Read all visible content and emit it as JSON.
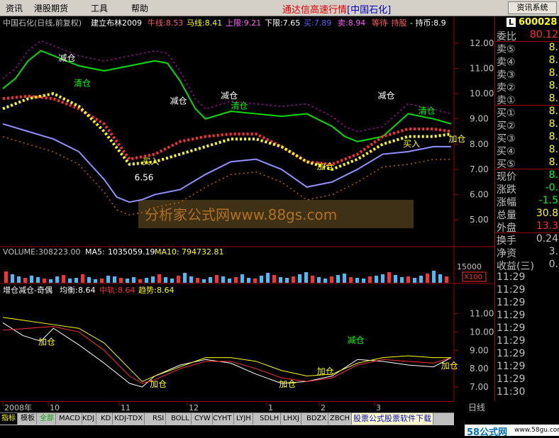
{
  "menu": {
    "items": [
      "资讯",
      "港股期货",
      "工具",
      "帮助"
    ],
    "title_prefix": "通达信高速行情",
    "title_code": "[中国石化]",
    "info_button": "资讯系统"
  },
  "header": {
    "title": "中国石化(日线,前复权)",
    "indicator": "建立布林2009",
    "params": [
      {
        "label": "牛线:",
        "value": "8.53",
        "color": "#ff6060"
      },
      {
        "label": "马线:",
        "value": "8.41",
        "color": "#ffff00"
      },
      {
        "label": "上限:",
        "value": "9.21",
        "color": "#ff60ff"
      },
      {
        "label": "下限:",
        "value": "7.65",
        "color": "#ffffff"
      },
      {
        "label": "买:",
        "value": "7.89",
        "color": "#6060ff"
      },
      {
        "label": "卖:",
        "value": "8.94",
        "color": "#ff60ff"
      },
      {
        "label": "等待",
        "value": "",
        "color": "#ff6060"
      },
      {
        "label": "- 持股",
        "value": "",
        "color": "#ff6060"
      },
      {
        "label": "- 持币:",
        "value": "8.9",
        "color": "#ffffff"
      }
    ]
  },
  "volume": {
    "label": "VOLUME:",
    "value": "308223.00",
    "ma5_label": "MA5:",
    "ma5": "1035059.19",
    "ma10_label": "MA10:",
    "ma10": "794732.81",
    "axis": "15000",
    "unit": "X100"
  },
  "sub": {
    "name": "增仓减仓-奇偶",
    "balance_label": "均衡:",
    "balance": "8.64",
    "mid_label": "中轨:",
    "mid": "8.64",
    "trend_label": "趋势:",
    "trend": "8.64"
  },
  "watermark": "分析家公式网www.88gs.com",
  "chart_data": [
    {
      "type": "line",
      "title": "中国石化(日线,前复权)",
      "y_ticks": [
        "12.00",
        "11.00",
        "10.00",
        "9.00",
        "8.00",
        "7.00",
        "6.00",
        "5.00"
      ],
      "ylim": [
        4.5,
        12.5
      ],
      "x_labels": [
        "2008年",
        "10",
        "11",
        "12",
        "1",
        "2",
        "3"
      ],
      "series": [
        {
          "name": "上限",
          "color": "#00e000",
          "x": [
            0,
            5,
            10,
            15,
            20,
            30,
            40,
            50,
            60,
            65,
            70,
            76,
            80,
            90,
            100,
            110,
            120,
            130,
            135,
            140,
            150,
            160,
            170,
            177
          ],
          "values": [
            10.2,
            10.6,
            11.3,
            11.7,
            11.5,
            11.1,
            10.9,
            11.1,
            11.3,
            11.2,
            10.5,
            9.4,
            9.0,
            9.3,
            9.2,
            9.1,
            9.2,
            8.7,
            8.3,
            8.1,
            8.3,
            9.2,
            9.0,
            8.8
          ]
        },
        {
          "name": "下限",
          "color": "#9090ff",
          "x": [
            0,
            10,
            20,
            30,
            40,
            45,
            50,
            55,
            60,
            70,
            80,
            90,
            100,
            110,
            120,
            130,
            140,
            150,
            160,
            170,
            177
          ],
          "values": [
            8.8,
            8.5,
            8.2,
            7.7,
            6.6,
            5.9,
            5.7,
            5.8,
            6.0,
            6.2,
            6.8,
            7.3,
            7.4,
            7.0,
            6.3,
            6.5,
            7.0,
            7.6,
            7.7,
            7.9,
            7.9
          ]
        },
        {
          "name": "牛线",
          "color": "#ff3030",
          "x": [
            0,
            10,
            20,
            30,
            40,
            50,
            60,
            70,
            80,
            90,
            100,
            110,
            120,
            130,
            140,
            150,
            160,
            170,
            177
          ],
          "values": [
            9.8,
            9.9,
            9.8,
            9.4,
            8.8,
            7.4,
            7.6,
            8.1,
            8.3,
            8.4,
            8.4,
            7.9,
            7.3,
            7.2,
            7.6,
            8.3,
            8.6,
            8.6,
            8.5
          ]
        },
        {
          "name": "马线",
          "color": "#ffff00",
          "x": [
            0,
            10,
            20,
            30,
            40,
            50,
            60,
            70,
            80,
            90,
            100,
            110,
            120,
            130,
            140,
            150,
            160,
            170,
            177
          ],
          "values": [
            9.4,
            9.8,
            10.0,
            9.5,
            8.5,
            7.2,
            7.3,
            7.6,
            7.9,
            8.2,
            8.2,
            7.9,
            7.3,
            7.0,
            7.4,
            8.0,
            8.3,
            8.3,
            8.4
          ]
        }
      ],
      "annotations": [
        {
          "text": "减仓",
          "x": 22,
          "y": 11.3,
          "color": "#ffffff"
        },
        {
          "text": "清仓",
          "x": 28,
          "y": 10.3,
          "color": "#00ff00"
        },
        {
          "text": "买入",
          "x": 55,
          "y": 7.2,
          "color": "#ffff00"
        },
        {
          "text": "6.56",
          "x": 52,
          "y": 6.56,
          "color": "#ffffff"
        },
        {
          "text": "减仓",
          "x": 66,
          "y": 9.6,
          "color": "#ffffff"
        },
        {
          "text": "减仓",
          "x": 86,
          "y": 9.8,
          "color": "#ffffff"
        },
        {
          "text": "清仓",
          "x": 90,
          "y": 9.4,
          "color": "#00ff00"
        },
        {
          "text": "加仓",
          "x": 124,
          "y": 7.0,
          "color": "#ffff00"
        },
        {
          "text": "减仓",
          "x": 148,
          "y": 9.8,
          "color": "#ffffff"
        },
        {
          "text": "清仓",
          "x": 164,
          "y": 9.2,
          "color": "#00ff00"
        },
        {
          "text": "买入",
          "x": 158,
          "y": 7.9,
          "color": "#ffff00"
        },
        {
          "text": "加仓",
          "x": 176,
          "y": 8.1,
          "color": "#ffff00"
        }
      ]
    },
    {
      "type": "line",
      "title": "增仓减仓-奇偶",
      "y_ticks": [
        "11.00",
        "10.00",
        "9.00",
        "8.00",
        "7.00"
      ],
      "ylim": [
        6.5,
        11.6
      ],
      "series": [
        {
          "name": "均衡",
          "color": "#ffffff",
          "x": [
            0,
            8,
            15,
            20,
            30,
            40,
            50,
            55,
            60,
            70,
            80,
            90,
            100,
            110,
            120,
            130,
            140,
            150,
            160,
            170,
            177
          ],
          "values": [
            10.5,
            9.8,
            9.5,
            10.2,
            9.3,
            8.3,
            7.2,
            7.0,
            7.6,
            8.2,
            8.5,
            8.3,
            7.7,
            7.2,
            7.3,
            7.6,
            8.5,
            8.4,
            8.2,
            8.1,
            8.6
          ]
        },
        {
          "name": "中轨",
          "color": "#ff3030",
          "x": [
            0,
            10,
            20,
            30,
            40,
            50,
            55,
            60,
            70,
            80,
            90,
            100,
            110,
            120,
            130,
            140,
            150,
            160,
            170,
            177
          ],
          "values": [
            10.1,
            10.2,
            10.3,
            10.0,
            9.0,
            7.6,
            7.2,
            7.4,
            8.0,
            8.4,
            8.4,
            8.0,
            7.5,
            7.3,
            7.5,
            8.2,
            8.5,
            8.4,
            8.3,
            8.6
          ]
        },
        {
          "name": "趋势",
          "color": "#ffff00",
          "x": [
            0,
            10,
            20,
            30,
            40,
            50,
            55,
            60,
            70,
            80,
            90,
            100,
            110,
            120,
            130,
            140,
            150,
            160,
            170,
            177
          ],
          "values": [
            10.8,
            10.6,
            10.4,
            10.2,
            9.4,
            8.0,
            7.3,
            7.6,
            8.1,
            8.6,
            8.6,
            8.4,
            7.9,
            7.6,
            7.7,
            8.3,
            8.6,
            8.7,
            8.6,
            8.6
          ]
        }
      ],
      "annotations": [
        {
          "text": "加仓",
          "x": 14,
          "y": 9.3,
          "color": "#ffff00"
        },
        {
          "text": "加仓",
          "x": 58,
          "y": 7.0,
          "color": "#ffff00"
        },
        {
          "text": "加仓",
          "x": 109,
          "y": 7.0,
          "color": "#ffff00"
        },
        {
          "text": "加仓",
          "x": 124,
          "y": 7.7,
          "color": "#ffff00"
        },
        {
          "text": "减仓",
          "x": 136,
          "y": 9.4,
          "color": "#00ff00"
        },
        {
          "text": "加仓",
          "x": 173,
          "y": 8.0,
          "color": "#ffff00"
        }
      ]
    }
  ],
  "side": {
    "code": "600028",
    "rows": [
      {
        "label": "委比",
        "value": "80.12",
        "color": "#ff3030"
      },
      {
        "label": "卖⑤",
        "value": "8.",
        "color": "#ffff00"
      },
      {
        "label": "卖④",
        "value": "8.",
        "color": "#ffff00"
      },
      {
        "label": "卖③",
        "value": "8.",
        "color": "#ffff00"
      },
      {
        "label": "卖②",
        "value": "8.",
        "color": "#ffff00"
      },
      {
        "label": "卖①",
        "value": "8.",
        "color": "#ffff00"
      },
      {
        "label": "买①",
        "value": "8.",
        "color": "#ffff00"
      },
      {
        "label": "买②",
        "value": "8.",
        "color": "#ffff00"
      },
      {
        "label": "买③",
        "value": "8.",
        "color": "#ffff00"
      },
      {
        "label": "买④",
        "value": "8.",
        "color": "#ffff00"
      },
      {
        "label": "买⑤",
        "value": "8.",
        "color": "#ffff00"
      },
      {
        "label": "现价",
        "value": "8.",
        "color": "#00ff00"
      },
      {
        "label": "涨跌",
        "value": "-0.",
        "color": "#00ff00"
      },
      {
        "label": "涨幅",
        "value": "-1.5",
        "color": "#00ff00"
      },
      {
        "label": "总量",
        "value": "30.8",
        "color": "#ffff00"
      },
      {
        "label": "外盘",
        "value": "13.3",
        "color": "#ff3030"
      },
      {
        "label": "换手",
        "value": "0.24",
        "color": "#c0c0c0"
      },
      {
        "label": "净资",
        "value": "3.",
        "color": "#c0c0c0"
      },
      {
        "label": "收益(三)",
        "value": "0.",
        "color": "#c0c0c0"
      }
    ],
    "ticks": [
      "11:29",
      "11:29",
      "11:29",
      "11:29",
      "11:29",
      "11:29",
      "11:29",
      "11:29",
      "11:29",
      "11:30"
    ]
  },
  "tabs": [
    "指标",
    "模板",
    "全部",
    "MACD",
    "KDJ",
    "KD",
    "KDJ-TDX",
    "RSI",
    "BOLL",
    "CYW",
    "CYHT",
    "LYJH",
    "SDLH",
    "LHXJ",
    "BDZX",
    "ZBCH"
  ],
  "promo": "股票公式股票软件下载",
  "period": "日线",
  "logo": "58公式网",
  "logo_url": "www.58gu.com"
}
